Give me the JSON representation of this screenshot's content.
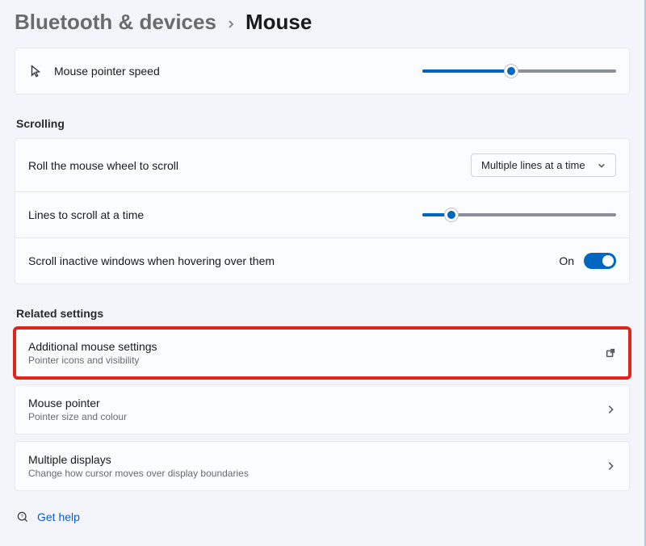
{
  "breadcrumb": {
    "parent": "Bluetooth & devices",
    "current": "Mouse"
  },
  "pointer_speed": {
    "label": "Mouse pointer speed",
    "value_pct": 46
  },
  "scrolling": {
    "title": "Scrolling",
    "roll": {
      "label": "Roll the mouse wheel to scroll",
      "selected": "Multiple lines at a time"
    },
    "lines": {
      "label": "Lines to scroll at a time",
      "value_pct": 15
    },
    "inactive": {
      "label": "Scroll inactive windows when hovering over them",
      "state_text": "On",
      "state": true
    }
  },
  "related": {
    "title": "Related settings",
    "items": [
      {
        "title": "Additional mouse settings",
        "sub": "Pointer icons and visibility",
        "action": "external",
        "highlight": true
      },
      {
        "title": "Mouse pointer",
        "sub": "Pointer size and colour",
        "action": "navigate",
        "highlight": false
      },
      {
        "title": "Multiple displays",
        "sub": "Change how cursor moves over display boundaries",
        "action": "navigate",
        "highlight": false
      }
    ]
  },
  "help": {
    "label": "Get help"
  }
}
